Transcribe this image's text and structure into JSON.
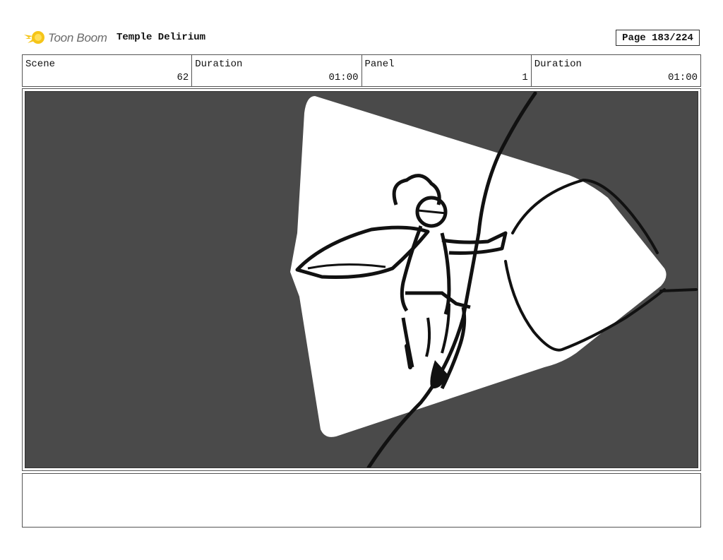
{
  "header": {
    "logo_text": "Toon Boom",
    "title": "Temple Delirium",
    "page_label": "Page 183/224"
  },
  "info": {
    "scene_label": "Scene",
    "scene_value": "62",
    "scene_duration_label": "Duration",
    "scene_duration_value": "01:00",
    "panel_label": "Panel",
    "panel_value": "1",
    "panel_duration_label": "Duration",
    "panel_duration_value": "01:00"
  },
  "panel": {
    "background_color": "#4a4a4a",
    "highlight_color": "#ffffff",
    "ink_color": "#111111"
  },
  "notes": {
    "text": ""
  },
  "logo_icon": "star-burst-icon",
  "accent": "#f5c518"
}
